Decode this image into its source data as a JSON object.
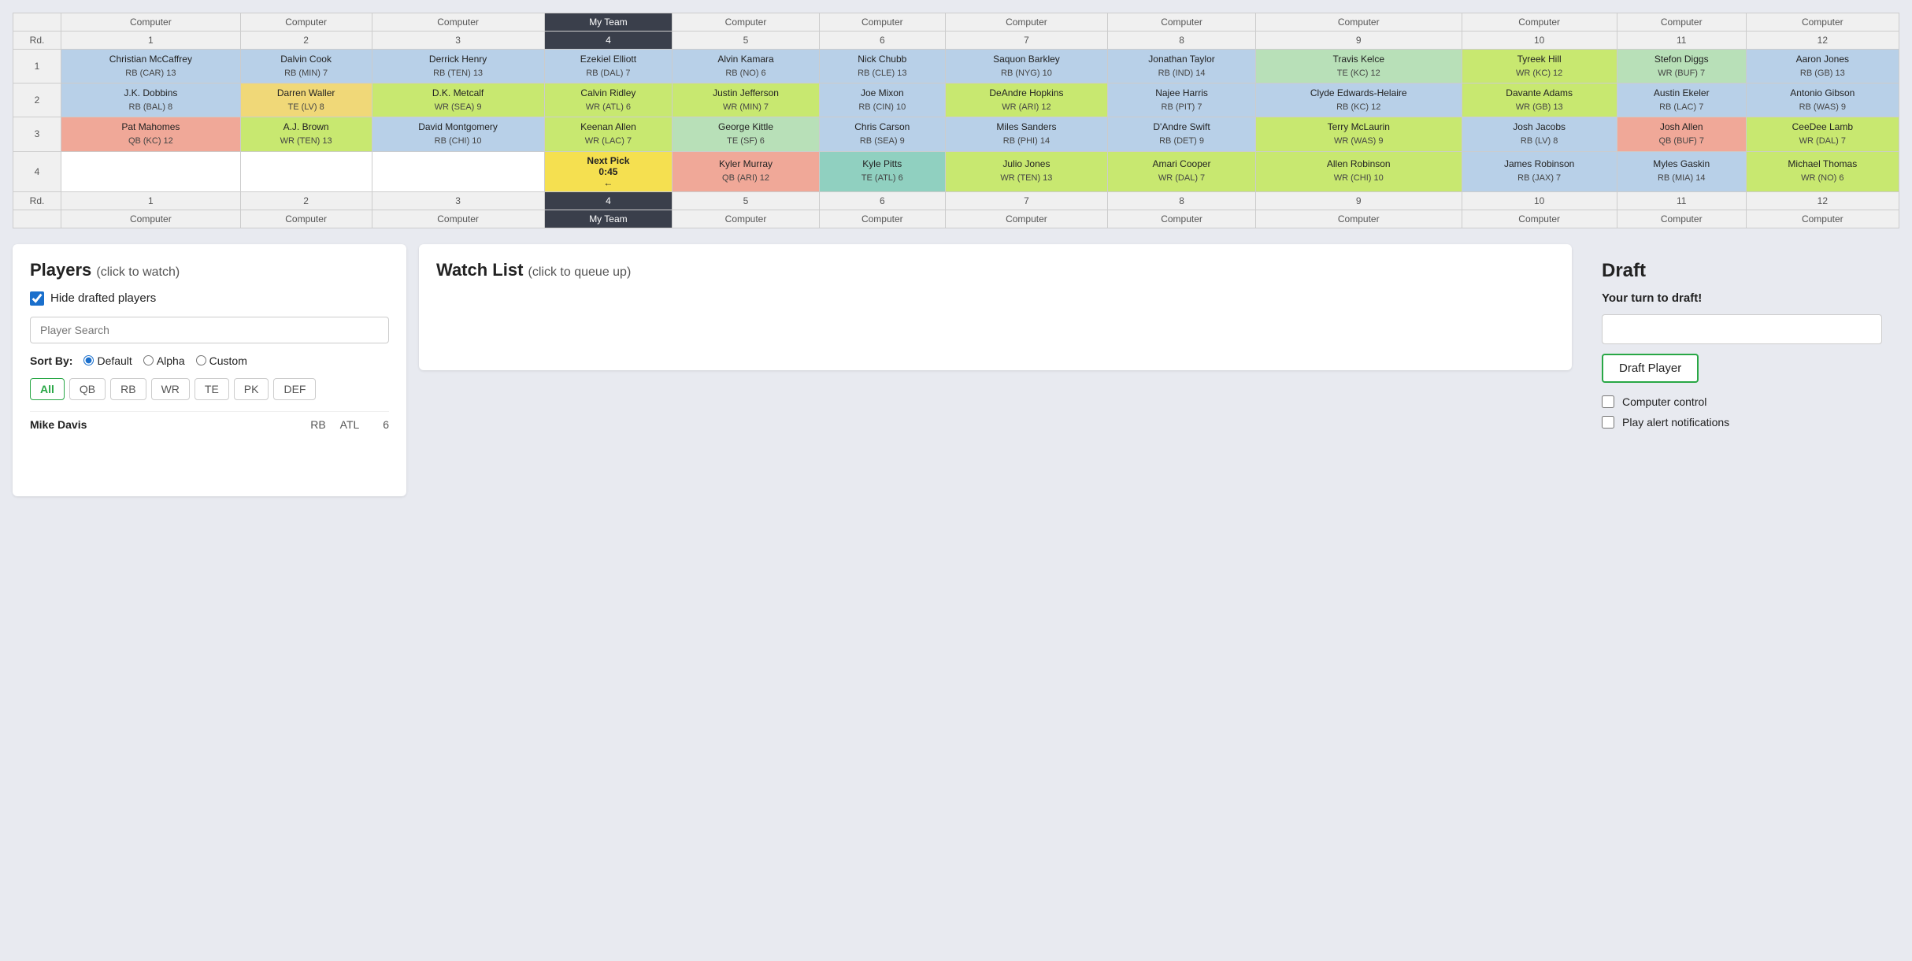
{
  "board": {
    "teams": [
      "Computer",
      "Computer",
      "Computer",
      "My Team",
      "Computer",
      "Computer",
      "Computer",
      "Computer",
      "Computer",
      "Computer",
      "Computer",
      "Computer"
    ],
    "teamNums": [
      "1",
      "2",
      "3",
      "4",
      "5",
      "6",
      "7",
      "8",
      "9",
      "10",
      "11",
      "12"
    ],
    "rounds": [
      {
        "round": "1",
        "picks": [
          {
            "name": "Christian McCaffrey",
            "pos": "RB (CAR) 13",
            "color": "blue"
          },
          {
            "name": "Dalvin Cook",
            "pos": "RB (MIN) 7",
            "color": "blue"
          },
          {
            "name": "Derrick Henry",
            "pos": "RB (TEN) 13",
            "color": "blue"
          },
          {
            "name": "Ezekiel Elliott",
            "pos": "RB (DAL) 7",
            "color": "blue"
          },
          {
            "name": "Alvin Kamara",
            "pos": "RB (NO) 6",
            "color": "blue"
          },
          {
            "name": "Nick Chubb",
            "pos": "RB (CLE) 13",
            "color": "blue"
          },
          {
            "name": "Saquon Barkley",
            "pos": "RB (NYG) 10",
            "color": "blue"
          },
          {
            "name": "Jonathan Taylor",
            "pos": "RB (IND) 14",
            "color": "blue"
          },
          {
            "name": "Travis Kelce",
            "pos": "TE (KC) 12",
            "color": "green"
          },
          {
            "name": "Tyreek Hill",
            "pos": "WR (KC) 12",
            "color": "lime"
          },
          {
            "name": "Stefon Diggs",
            "pos": "WR (BUF) 7",
            "color": "green"
          },
          {
            "name": "Aaron Jones",
            "pos": "RB (GB) 13",
            "color": "blue"
          }
        ]
      },
      {
        "round": "2",
        "picks": [
          {
            "name": "J.K. Dobbins",
            "pos": "RB (BAL) 8",
            "color": "blue"
          },
          {
            "name": "Darren Waller",
            "pos": "TE (LV) 8",
            "color": "yellow"
          },
          {
            "name": "D.K. Metcalf",
            "pos": "WR (SEA) 9",
            "color": "lime"
          },
          {
            "name": "Calvin Ridley",
            "pos": "WR (ATL) 6",
            "color": "lime"
          },
          {
            "name": "Justin Jefferson",
            "pos": "WR (MIN) 7",
            "color": "lime"
          },
          {
            "name": "Joe Mixon",
            "pos": "RB (CIN) 10",
            "color": "blue"
          },
          {
            "name": "DeAndre Hopkins",
            "pos": "WR (ARI) 12",
            "color": "lime"
          },
          {
            "name": "Najee Harris",
            "pos": "RB (PIT) 7",
            "color": "blue"
          },
          {
            "name": "Clyde Edwards-Helaire",
            "pos": "RB (KC) 12",
            "color": "blue"
          },
          {
            "name": "Davante Adams",
            "pos": "WR (GB) 13",
            "color": "lime"
          },
          {
            "name": "Austin Ekeler",
            "pos": "RB (LAC) 7",
            "color": "blue"
          },
          {
            "name": "Antonio Gibson",
            "pos": "RB (WAS) 9",
            "color": "blue"
          }
        ]
      },
      {
        "round": "3",
        "picks": [
          {
            "name": "Pat Mahomes",
            "pos": "QB (KC) 12",
            "color": "salmon"
          },
          {
            "name": "A.J. Brown",
            "pos": "WR (TEN) 13",
            "color": "lime"
          },
          {
            "name": "David Montgomery",
            "pos": "RB (CHI) 10",
            "color": "blue"
          },
          {
            "name": "Keenan Allen",
            "pos": "WR (LAC) 7",
            "color": "lime"
          },
          {
            "name": "George Kittle",
            "pos": "TE (SF) 6",
            "color": "green"
          },
          {
            "name": "Chris Carson",
            "pos": "RB (SEA) 9",
            "color": "blue"
          },
          {
            "name": "Miles Sanders",
            "pos": "RB (PHI) 14",
            "color": "blue"
          },
          {
            "name": "D'Andre Swift",
            "pos": "RB (DET) 9",
            "color": "blue"
          },
          {
            "name": "Terry McLaurin",
            "pos": "WR (WAS) 9",
            "color": "lime"
          },
          {
            "name": "Josh Jacobs",
            "pos": "RB (LV) 8",
            "color": "blue"
          },
          {
            "name": "Josh Allen",
            "pos": "QB (BUF) 7",
            "color": "salmon"
          },
          {
            "name": "CeeDee Lamb",
            "pos": "WR (DAL) 7",
            "color": "lime"
          }
        ]
      },
      {
        "round": "4",
        "picks": [
          {
            "name": "",
            "pos": "",
            "color": ""
          },
          {
            "name": "",
            "pos": "",
            "color": ""
          },
          {
            "name": "",
            "pos": "",
            "color": ""
          },
          {
            "name": "Next Pick 0:45 ←",
            "pos": "",
            "color": "next-pick"
          },
          {
            "name": "Kyler Murray",
            "pos": "QB (ARI) 12",
            "color": "salmon"
          },
          {
            "name": "Kyle Pitts",
            "pos": "TE (ATL) 6",
            "color": "teal"
          },
          {
            "name": "Julio Jones",
            "pos": "WR (TEN) 13",
            "color": "lime"
          },
          {
            "name": "Amari Cooper",
            "pos": "WR (DAL) 7",
            "color": "lime"
          },
          {
            "name": "Allen Robinson",
            "pos": "WR (CHI) 10",
            "color": "lime"
          },
          {
            "name": "James Robinson",
            "pos": "RB (JAX) 7",
            "color": "blue"
          },
          {
            "name": "Myles Gaskin",
            "pos": "RB (MIA) 14",
            "color": "blue"
          },
          {
            "name": "Michael Thomas",
            "pos": "WR (NO) 6",
            "color": "lime"
          }
        ]
      }
    ]
  },
  "players_panel": {
    "title": "Players",
    "subtitle": "(click to watch)",
    "hide_drafted_label": "Hide drafted players",
    "hide_drafted_checked": true,
    "search_placeholder": "Player Search",
    "sort_label": "Sort By:",
    "sort_options": [
      "Default",
      "Alpha",
      "Custom"
    ],
    "sort_default": "Default",
    "positions": [
      "All",
      "QB",
      "RB",
      "WR",
      "TE",
      "PK",
      "DEF"
    ],
    "active_position": "All",
    "players": [
      {
        "name": "Mike Davis",
        "pos": "RB",
        "team": "ATL",
        "num": "6"
      }
    ]
  },
  "watchlist_panel": {
    "title": "Watch List",
    "subtitle": "(click to queue up)"
  },
  "draft_panel": {
    "title": "Draft",
    "your_turn": "Your turn to draft!",
    "draft_button_label": "Draft Player",
    "computer_control_label": "Computer control",
    "play_alerts_label": "Play alert notifications",
    "computer_control_checked": false,
    "play_alerts_checked": false
  }
}
